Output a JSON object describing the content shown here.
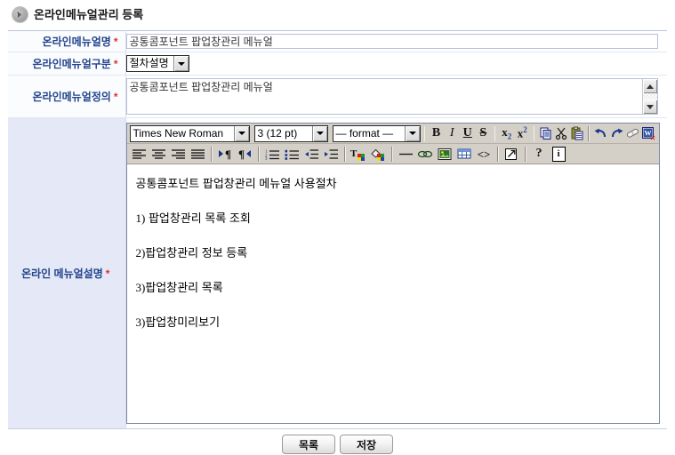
{
  "header": {
    "icon": "circle-arrow-icon",
    "title": "온라인메뉴얼관리 등록"
  },
  "form": {
    "rows": [
      {
        "label": "온라인메뉴얼명",
        "required": "*"
      },
      {
        "label": "온라인메뉴얼구분",
        "required": "*"
      },
      {
        "label": "온라인메뉴얼정의",
        "required": "*"
      },
      {
        "label": "온라인 메뉴얼설명",
        "required": "*"
      }
    ],
    "manual_name": {
      "value": "공통콤포넌트 팝업창관리 메뉴얼",
      "placeholder": ""
    },
    "manual_type": {
      "selected": "절차설명",
      "options": [
        "절차설명"
      ]
    },
    "manual_definition": {
      "value": "공통콤포넌트 팝업창관리 메뉴얼",
      "placeholder": ""
    }
  },
  "editor": {
    "toolbar_row1": {
      "font_select": {
        "selected": "Times New Roman"
      },
      "size_select": {
        "selected": "3 (12 pt)"
      },
      "format_select": {
        "selected": "— format —"
      },
      "buttons": [
        {
          "name": "bold-button",
          "glyph": "B"
        },
        {
          "name": "italic-button",
          "glyph": "I"
        },
        {
          "name": "underline-button",
          "glyph": "U"
        },
        {
          "name": "strikethrough-button",
          "glyph": "S"
        },
        {
          "name": "subscript-button",
          "glyph": "x₂"
        },
        {
          "name": "superscript-button",
          "glyph": "x²"
        },
        {
          "name": "copy-button",
          "glyph": "copy-icon"
        },
        {
          "name": "cut-button",
          "glyph": "scissors-icon"
        },
        {
          "name": "paste-button",
          "glyph": "clipboard-icon"
        },
        {
          "name": "undo-button",
          "glyph": "undo-icon"
        },
        {
          "name": "redo-button",
          "glyph": "redo-icon"
        },
        {
          "name": "erase-format-button",
          "glyph": "eraser-icon"
        },
        {
          "name": "paste-from-word-button",
          "glyph": "word-doc-icon"
        }
      ]
    },
    "toolbar_row2": {
      "buttons": [
        {
          "name": "align-left-button",
          "glyph": "align-left-icon"
        },
        {
          "name": "align-center-button",
          "glyph": "align-center-icon"
        },
        {
          "name": "align-right-button",
          "glyph": "align-right-icon"
        },
        {
          "name": "align-justify-button",
          "glyph": "align-justify-icon"
        },
        {
          "name": "direction-ltr-button",
          "glyph": "pilcrow-ltr-icon"
        },
        {
          "name": "direction-rtl-button",
          "glyph": "pilcrow-rtl-icon"
        },
        {
          "name": "ordered-list-button",
          "glyph": "numbered-list-icon"
        },
        {
          "name": "unordered-list-button",
          "glyph": "bullet-list-icon"
        },
        {
          "name": "outdent-button",
          "glyph": "outdent-icon"
        },
        {
          "name": "indent-button",
          "glyph": "indent-icon"
        },
        {
          "name": "text-color-button",
          "glyph": "text-color-icon"
        },
        {
          "name": "background-color-button",
          "glyph": "fill-color-icon"
        },
        {
          "name": "horizontal-rule-button",
          "glyph": "horizontal-rule-icon"
        },
        {
          "name": "insert-link-button",
          "glyph": "link-icon"
        },
        {
          "name": "insert-image-button",
          "glyph": "image-icon"
        },
        {
          "name": "insert-table-button",
          "glyph": "table-icon"
        },
        {
          "name": "source-code-button",
          "glyph": "code-brackets-icon"
        },
        {
          "name": "popup-window-button",
          "glyph": "external-window-icon"
        },
        {
          "name": "help-button",
          "glyph": "?"
        },
        {
          "name": "about-button",
          "glyph": "i"
        }
      ]
    },
    "content": {
      "lines": [
        {
          "num": "",
          "text": "공통콤포넌트 팝업창관리 메뉴얼 사용절차"
        },
        {
          "num": "1)",
          "text": " 팝업창관리 목록 조회"
        },
        {
          "num": "2)",
          "text": "팝업창관리 정보 등록"
        },
        {
          "num": "3)",
          "text": "팝업창관리 목록"
        },
        {
          "num": "3)",
          "text": "팝업창미리보기"
        }
      ]
    }
  },
  "footer": {
    "list_button": "목록",
    "save_button": "저장"
  },
  "colors": {
    "label_text": "#23458c",
    "required": "#d33333",
    "label_bg_light": "#fbfcfe",
    "label_bg_tall": "#e4e8f7",
    "toolbar_bg": "#d4d0c8",
    "table_border": "#d5dced"
  }
}
